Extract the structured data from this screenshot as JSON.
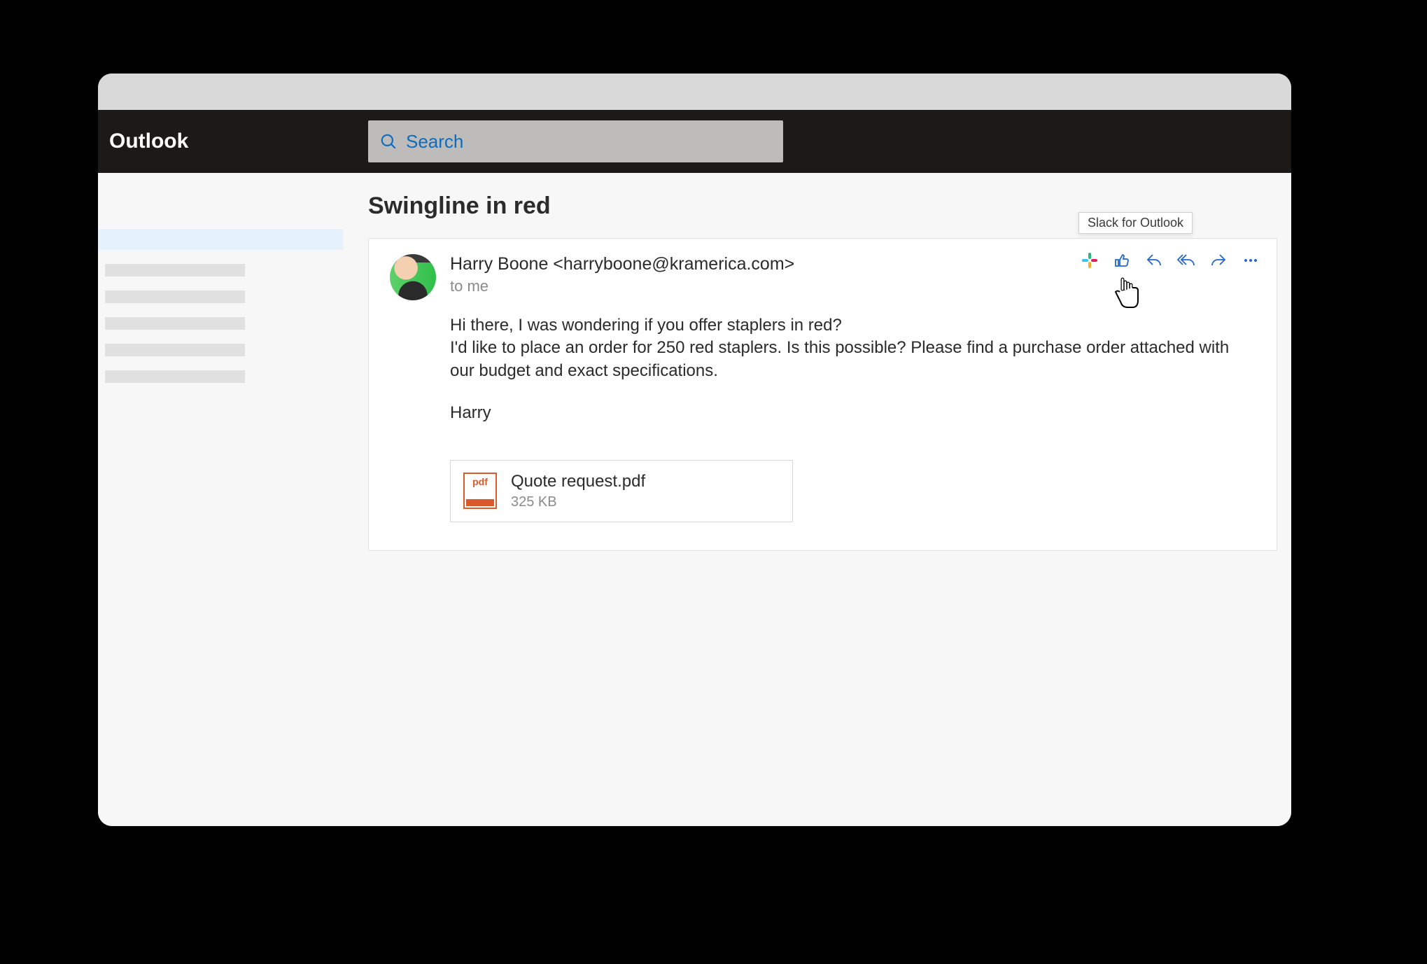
{
  "app": {
    "name": "Outlook"
  },
  "search": {
    "placeholder": "Search"
  },
  "email": {
    "subject": "Swingline in red",
    "from_display": "Harry Boone <harryboone@kramerica.com>",
    "to_display": "to me",
    "body_line1": "Hi there, I was wondering if you offer staplers in red?",
    "body_line2": "I'd like to place an order for 250 red staplers. Is this possible? Please find a purchase order attached with our budget and exact specifications.",
    "signoff": "Harry",
    "attachment": {
      "name": "Quote request.pdf",
      "size": "325 KB",
      "type_label": "pdf"
    }
  },
  "tooltip": {
    "slack": "Slack for Outlook"
  }
}
